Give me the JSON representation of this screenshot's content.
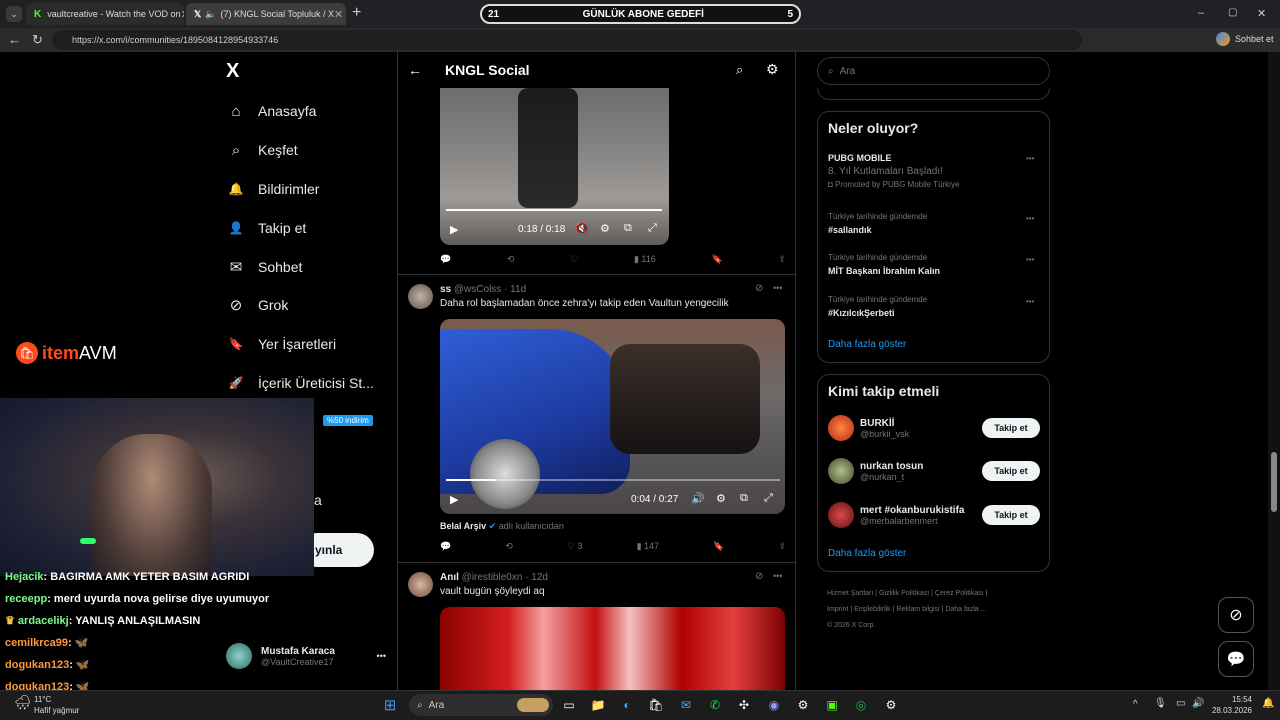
{
  "browser": {
    "tabs": [
      {
        "title": "vaultcreative - Watch the VOD on",
        "favicon": "kick-icon"
      },
      {
        "title": "(7) KNGL Social Topluluk / X",
        "favicon": "x-icon"
      }
    ],
    "new_tab": "+",
    "url": "https://x.com/i/communities/1895084128954933746",
    "copilot_label": "Sohbet et",
    "window_controls": [
      "–",
      "▢",
      "✕"
    ]
  },
  "goal_bar": {
    "left": "21",
    "label": "GÜNLÜK ABONE GEDEFİ",
    "right": "5"
  },
  "sidebar": {
    "logo": "X",
    "items": [
      {
        "label": "Anasayfa",
        "icon": "home-icon",
        "glyph": "⌂"
      },
      {
        "label": "Keşfet",
        "icon": "search-icon",
        "glyph": "⌕"
      },
      {
        "label": "Bildirimler",
        "icon": "bell-icon",
        "glyph": "🔔"
      },
      {
        "label": "Takip et",
        "icon": "add-user-icon",
        "glyph": "👤"
      },
      {
        "label": "Sohbet",
        "icon": "mail-icon",
        "glyph": "✉"
      },
      {
        "label": "Grok",
        "icon": "grok-icon",
        "glyph": "⊘"
      },
      {
        "label": "Yer İşaretleri",
        "icon": "bookmark-icon",
        "glyph": "🔖"
      },
      {
        "label": "İçerik Üreticisi St...",
        "icon": "rocket-icon",
        "glyph": "🚀"
      }
    ],
    "premium_badge": "%50 indirim",
    "partial_label": "a",
    "post_button": "yınla",
    "account": {
      "name": "Mustafa Karaca",
      "handle": "@VaultCreative17",
      "more": "•••"
    }
  },
  "overlay": {
    "brand_a": "item",
    "brand_b": "AVM",
    "chat": [
      {
        "user": "Hejacik",
        "text": ": BAGIRMA AMK YETER BASIM AGRIDI"
      },
      {
        "user": "receepp",
        "text": ": merd uyurda nova gelirse diye uyumuyor"
      },
      {
        "user": "ardacelikj",
        "text": ": YANLIŞ ANLAŞILMASIN"
      },
      {
        "user": "cemilkrca99",
        "text": ":"
      },
      {
        "user": "dogukan123",
        "text": ":"
      },
      {
        "user": "dogukan123",
        "text": ":"
      }
    ],
    "weather": {
      "temp": "11°C",
      "desc": "Hafif yağmur"
    }
  },
  "header": {
    "title": "KNGL Social",
    "back": "←"
  },
  "posts": [
    {
      "video_time": "0:18 / 0:18",
      "stats": {
        "reply": "",
        "retweet": "",
        "like": "",
        "views": "116"
      }
    },
    {
      "name": "ss",
      "handle": "@wsColss",
      "age": "· 11d",
      "text": "Daha rol başlamadan önce zehra'yı takip eden Vaultun yengecilik",
      "video_time": "0:04 / 0:27",
      "source_name": "Belal Arşiv",
      "source_suffix": "adlı kullanıcıdan",
      "stats": {
        "reply": "",
        "retweet": "",
        "like": "3",
        "views": "147"
      }
    },
    {
      "name": "Anıl",
      "handle": "@irestible0xn",
      "age": "· 12d",
      "text": "vault bugün şöyleydi aq"
    }
  ],
  "right": {
    "search_placeholder": "Ara",
    "trends_title": "Neler oluyor?",
    "trends": [
      {
        "meta": "",
        "title": "PUBG MOBILE",
        "sub": "8. Yıl Kutlamaları Başladı!",
        "promo": "Promoted by PUBG Mobile Türkiye"
      },
      {
        "meta": "Türkiye tarihinde gündemde",
        "title": "#sallandık"
      },
      {
        "meta": "Türkiye tarihinde gündemde",
        "title": "MİT Başkanı İbrahim Kalın"
      },
      {
        "meta": "Türkiye tarihinde gündemde",
        "title": "#KızılcıkŞerbeti"
      }
    ],
    "show_more": "Daha fazla göster",
    "follow_title": "Kimi takip etmeli",
    "follows": [
      {
        "name": "BURKİİ",
        "handle": "@burkii_vsk",
        "button": "Takip et"
      },
      {
        "name": "nurkan tosun",
        "handle": "@nurkan_t",
        "button": "Takip et"
      },
      {
        "name": "mert #okanburukistifa",
        "handle": "@merbalarbenmert",
        "button": "Takip et"
      }
    ],
    "follow_more": "Daha fazla göster",
    "footer": [
      "Hizmet Şartları",
      "Gizlilik Politikası",
      "Çerez Politikası",
      "Imprint",
      "Erişilebilirlik",
      "Reklam bilgisi",
      "Daha fazla ...",
      "© 2026 X Corp."
    ]
  },
  "taskbar": {
    "search": "Ara",
    "time": "15:54",
    "date": "28.03.2026"
  }
}
